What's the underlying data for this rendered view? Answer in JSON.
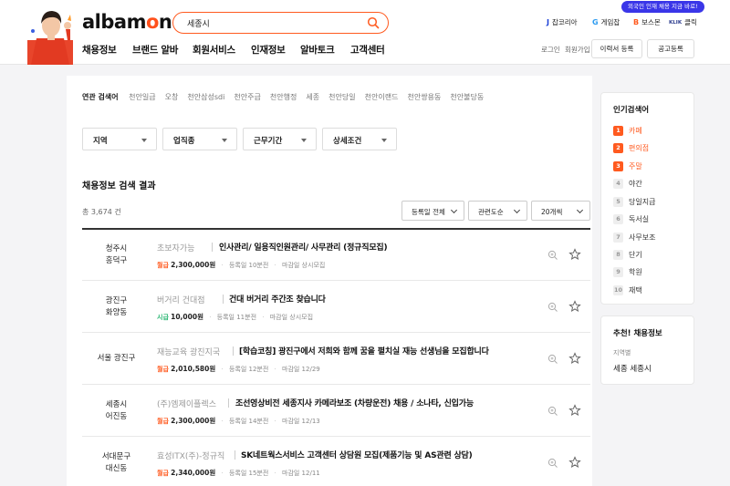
{
  "header": {
    "logo_text": "albamon",
    "search_value": "세종시",
    "promo_badge": "외국인 인재 채용 지금 바로!",
    "family_sites": [
      {
        "badge": "J",
        "label": "잡코리아",
        "color": "#1a3fd6"
      },
      {
        "badge": "G",
        "label": "게임잡",
        "color": "#2c9bf0"
      },
      {
        "badge": "B",
        "label": "보스몬",
        "color": "#ff5a1f"
      },
      {
        "badge": "KLIK",
        "label": "클릭",
        "color": "#2a3a8c"
      }
    ],
    "nav": [
      "채용정보",
      "브랜드 알바",
      "회원서비스",
      "인재정보",
      "알바토크",
      "고객센터"
    ],
    "login": "로그인",
    "signup": "회원가입",
    "resume_button": "이력서 등록",
    "post_button": "공고등록"
  },
  "related": {
    "label": "연관 검색어",
    "keywords": [
      "천안일급",
      "오창",
      "천안삼성sdi",
      "천안주급",
      "천안행정",
      "세종",
      "천안당일",
      "천안이랜드",
      "천안쌍용동",
      "천안불당동"
    ]
  },
  "filters": [
    "지역",
    "업직종",
    "근무기간",
    "상세조건"
  ],
  "results": {
    "title": "채용정보 검색 결과",
    "total": "총 3,674 건",
    "sort_options": [
      "등록일 전체",
      "관련도순",
      "20개씩"
    ]
  },
  "jobs": [
    {
      "loc1": "청주시",
      "loc2": "흥덕구",
      "company": "초보자가능",
      "title": "인사관리/ 일용직인원관리/ 사무관리 (정규직모집)",
      "pay_type": "월급",
      "pay_color": "#ff5a1f",
      "pay": "2,300,000원",
      "registered": "등록일 10분전",
      "deadline": "마감일 상시모집"
    },
    {
      "loc1": "광진구",
      "loc2": "화양동",
      "company": "버거리 건대점",
      "title": "건대 버거리 주간조 찾습니다",
      "pay_type": "시급",
      "pay_color": "#2bb673",
      "pay": "10,000원",
      "registered": "등록일 11분전",
      "deadline": "마감일 상시모집"
    },
    {
      "loc1": "서울 광진구",
      "loc2": "",
      "company": "재능교육 광진지국",
      "title": "[학습코칭] 광진구에서 저희와 함께 꿈을 펼치실 재능 선생님을 모집합니다",
      "pay_type": "월급",
      "pay_color": "#ff5a1f",
      "pay": "2,010,580원",
      "registered": "등록일 12분전",
      "deadline": "마감일 12/29"
    },
    {
      "loc1": "세종시",
      "loc2": "어진동",
      "company": "(주)엠제이플렉스",
      "title": "조선영상비전 세종지사 카메라보조 (차량운전) 채용 / 소나타, 신입가능",
      "pay_type": "월급",
      "pay_color": "#ff5a1f",
      "pay": "2,300,000원",
      "registered": "등록일 14분전",
      "deadline": "마감일 12/13"
    },
    {
      "loc1": "서대문구",
      "loc2": "대신동",
      "company": "효성ITX(주)-정규직",
      "title": "SK네트웍스서비스 고객센터 상담원 모집(제품기능 및 AS관련 상담)",
      "pay_type": "월급",
      "pay_color": "#ff5a1f",
      "pay": "2,340,000원",
      "registered": "등록일 15분전",
      "deadline": "마감일 12/11"
    }
  ],
  "popular": {
    "title": "인기검색어",
    "items": [
      {
        "num": "1",
        "word": "카페"
      },
      {
        "num": "2",
        "word": "편의점"
      },
      {
        "num": "3",
        "word": "주말"
      },
      {
        "num": "4",
        "word": "야간"
      },
      {
        "num": "5",
        "word": "당일지급"
      },
      {
        "num": "6",
        "word": "독서실"
      },
      {
        "num": "7",
        "word": "사무보조"
      },
      {
        "num": "8",
        "word": "단기"
      },
      {
        "num": "9",
        "word": "학원"
      },
      {
        "num": "10",
        "word": "재택"
      }
    ]
  },
  "recommend": {
    "title": "추천! 채용정보",
    "sub": "지역별",
    "value": "세종 세종시"
  }
}
